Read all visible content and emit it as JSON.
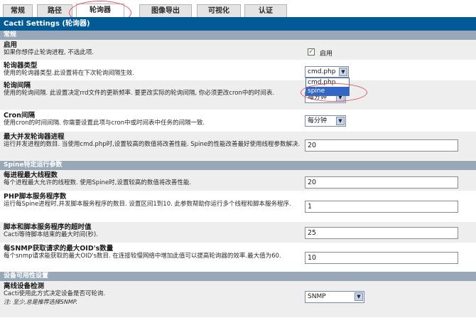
{
  "tabs": [
    {
      "label": "常规"
    },
    {
      "label": "路径"
    },
    {
      "label": "轮询器"
    },
    {
      "label": "图像导出"
    },
    {
      "label": "可视化"
    },
    {
      "label": "认证"
    }
  ],
  "title": "Cacti Settings (轮询器)",
  "sections": {
    "general": "常规",
    "spine": "Spine特定运行参数",
    "availability": "设备可用性设置"
  },
  "rows": {
    "enable": {
      "label": "启用",
      "desc": "如果你想停止轮询进程, 不选此项.",
      "checkbox_label": "启用",
      "checked": true
    },
    "poller_type": {
      "label": "轮询器类型",
      "desc": "使用的轮询器类型.此设置将在下次轮询间隔生效.",
      "value": "cmd.php"
    },
    "poller_interval": {
      "label": "轮询间隔",
      "desc": "使用的轮询间隔. 此设置决定rrd文件的更新频率. 要更改实际的轮询间隔, 你必须更改cron中的时间表.",
      "value": "每分钟"
    },
    "cron_interval": {
      "label": "Cron间隔",
      "desc": "使用cron的时间间隔. 你需要设置此项与cron中或时间表中任务的间隔一致.",
      "value": "每分钟"
    },
    "max_procs": {
      "label": "最大并发轮询器进程",
      "desc": "运行并发进程的数目. 当使用cmd.php时,设置较高的数值将改善性能. Spine的性能改善最好使用线程参数解决.",
      "value": "20"
    },
    "threads": {
      "label": "每进程最大线程数",
      "desc": "每个进程最大允许的线程数. 使用Spine时,设置较高的数值将改善性能.",
      "value": "20"
    },
    "php_servers": {
      "label": "PHP脚本服务程序数",
      "desc": "运行每Spine进程时,并发脚本服务程序的数目. 设置区间1到10. 此参数帮助你运行多个线程和脚本服务程序.",
      "value": "1"
    },
    "script_timeout": {
      "label": "脚本和脚本服务程序的超时值",
      "desc": "Cacti等待脚本结束的最大时间(秒).",
      "value": "25"
    },
    "max_oids": {
      "label": "每SNMP获取请求的最大OID's数量",
      "desc": "每个snmp请求能获取的最大OID's数目. 在连接较慢网络中增加此值可以提高轮询器的效率.最大值为60.",
      "value": "10"
    },
    "downed_detection": {
      "label": "离线设备检测",
      "desc": "Cacti使用此方式决定设备是否可轮询.",
      "note": "注: 至少,总是推荐选择SNMP.",
      "value": "SNMP"
    }
  },
  "dropdown": {
    "options": [
      "cmd.php",
      "spine"
    ],
    "selected": "spine"
  },
  "colors": {
    "title_bar": "#005a95",
    "section_header": "#98a8b8",
    "annotation": "#e0566d",
    "dropdown_selected": "#3267c8"
  }
}
